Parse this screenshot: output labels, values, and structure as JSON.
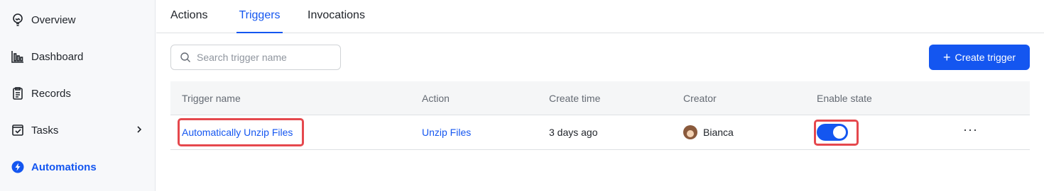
{
  "sidebar": {
    "items": [
      {
        "label": "Overview",
        "icon": "lightbulb-icon"
      },
      {
        "label": "Dashboard",
        "icon": "bar-chart-icon"
      },
      {
        "label": "Records",
        "icon": "clipboard-icon"
      },
      {
        "label": "Tasks",
        "icon": "task-check-icon"
      },
      {
        "label": "Automations",
        "icon": "automation-bolt-icon"
      }
    ]
  },
  "tabs": [
    {
      "label": "Actions"
    },
    {
      "label": "Triggers"
    },
    {
      "label": "Invocations"
    }
  ],
  "search": {
    "placeholder": "Search trigger name",
    "value": ""
  },
  "toolbar": {
    "create_label": "Create trigger",
    "create_icon": "plus-icon"
  },
  "table": {
    "columns": [
      "Trigger name",
      "Action",
      "Create time",
      "Creator",
      "Enable state"
    ],
    "rows": [
      {
        "trigger_name": "Automatically Unzip Files",
        "action": "Unzip Files",
        "create_time": "3 days ago",
        "creator": "Bianca",
        "enabled": true,
        "more": "···"
      }
    ]
  },
  "colors": {
    "accent": "#1456f0",
    "highlight": "#e5484d",
    "sidebar_bg": "#f7f8fa",
    "header_bg": "#f5f6f7"
  }
}
